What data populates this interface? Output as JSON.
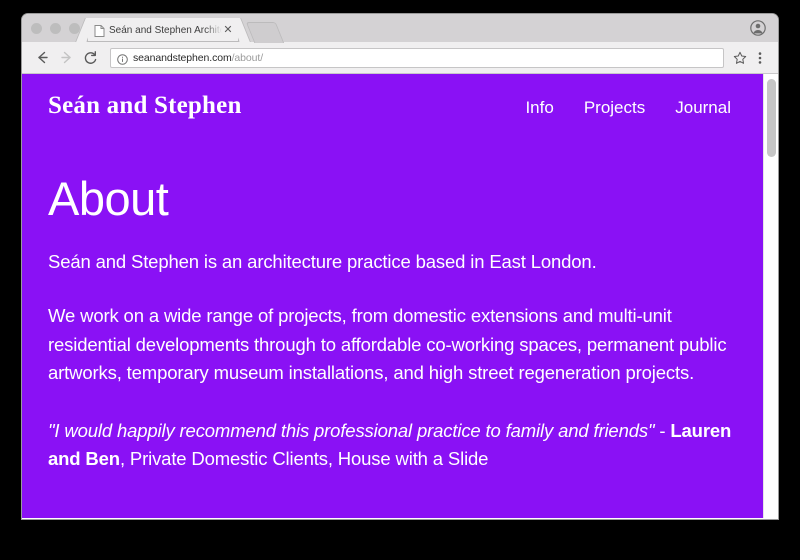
{
  "browser": {
    "traffic_lights": [
      "close",
      "minimize",
      "maximize"
    ],
    "tab": {
      "title": "Seán and Stephen Architects",
      "favicon": "page-icon",
      "close_label": "✕"
    },
    "new_tab_label": "+",
    "toolbar": {
      "back_label": "←",
      "forward_label": "→",
      "reload_label": "C",
      "site_info_icon": "info-circle-icon",
      "url_domain": "seanandstephen.com",
      "url_path": "/about/",
      "bookmark_icon": "star-icon",
      "menu_icon": "three-dots-icon",
      "profile_icon": "account-icon"
    }
  },
  "site": {
    "logo": "Seán and Stephen",
    "nav": [
      {
        "label": "Info"
      },
      {
        "label": "Projects"
      },
      {
        "label": "Journal"
      }
    ],
    "page_title": "About",
    "paragraphs": [
      "Seán and Stephen is an architecture practice based in East London.",
      "We work on a wide range of projects, from domestic extensions and multi-unit residential developments through to affordable co-working spaces, permanent public artworks, temporary museum installations, and high street regeneration projects."
    ],
    "testimonial": {
      "quote": "\"I would happily recommend this professional practice to family and friends\"",
      "separator": "  - ",
      "author": "Lauren and Ben",
      "attribution": ", Private Domestic Clients, House with a Slide"
    },
    "colors": {
      "background": "#8a11f5",
      "text": "#ffffff"
    }
  },
  "scrollbar": {
    "position": "top"
  }
}
